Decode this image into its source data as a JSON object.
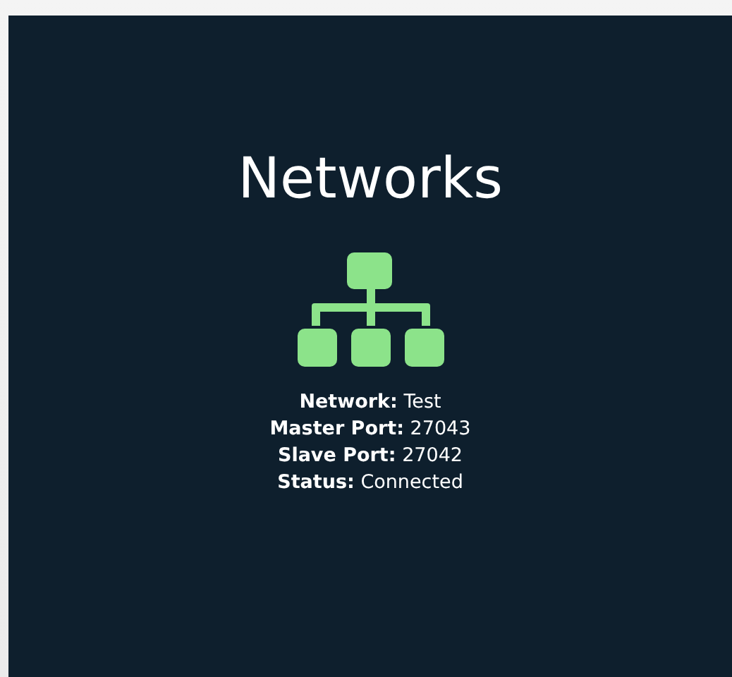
{
  "title": "Networks",
  "details": [
    {
      "label": "Network:",
      "value": "Test"
    },
    {
      "label": "Master Port:",
      "value": "27043"
    },
    {
      "label": "Slave Port:",
      "value": "27042"
    },
    {
      "label": "Status:",
      "value": "Connected"
    }
  ]
}
